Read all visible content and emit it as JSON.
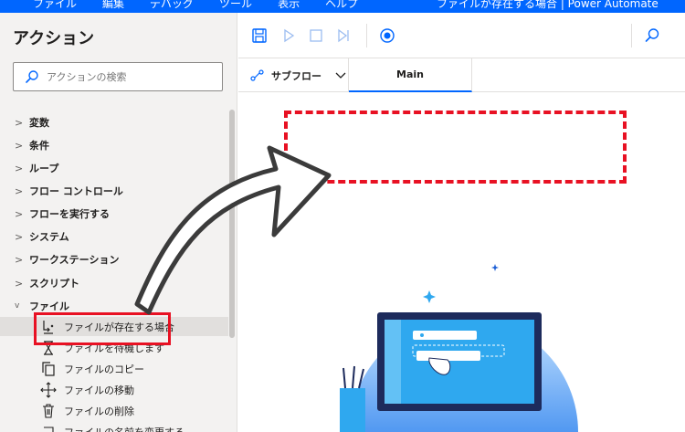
{
  "menubar": {
    "items": [
      "ファイル",
      "編集",
      "デバッグ",
      "ツール",
      "表示",
      "ヘルプ"
    ],
    "window_title": "ファイルが存在する場合 | Power Automate"
  },
  "left_panel": {
    "title": "アクション",
    "search_placeholder": "アクションの検索",
    "categories": [
      {
        "label": "変数",
        "chevron": ">"
      },
      {
        "label": "条件",
        "chevron": ">"
      },
      {
        "label": "ループ",
        "chevron": ">"
      },
      {
        "label": "フロー コントロール",
        "chevron": ">"
      },
      {
        "label": "フローを実行する",
        "chevron": ">"
      },
      {
        "label": "システム",
        "chevron": ">"
      },
      {
        "label": "ワークステーション",
        "chevron": ">"
      },
      {
        "label": "スクリプト",
        "chevron": ">"
      },
      {
        "label": "ファイル",
        "chevron": "v"
      }
    ],
    "file_actions": [
      {
        "label": "ファイルが存在する場合",
        "icon": "file-exists-icon"
      },
      {
        "label": "ファイルを待機します",
        "icon": "hourglass-icon"
      },
      {
        "label": "ファイルのコピー",
        "icon": "copy-icon"
      },
      {
        "label": "ファイルの移動",
        "icon": "move-icon"
      },
      {
        "label": "ファイルの削除",
        "icon": "trash-icon"
      },
      {
        "label": "ファイルの名前を変更する",
        "icon": "rename-icon"
      }
    ]
  },
  "tabs": {
    "subflow_label": "サブフロー",
    "main_label": "Main"
  },
  "colors": {
    "accent": "#0066ff",
    "highlight_red": "#e81123",
    "panel_bg": "#f3f2f1"
  }
}
